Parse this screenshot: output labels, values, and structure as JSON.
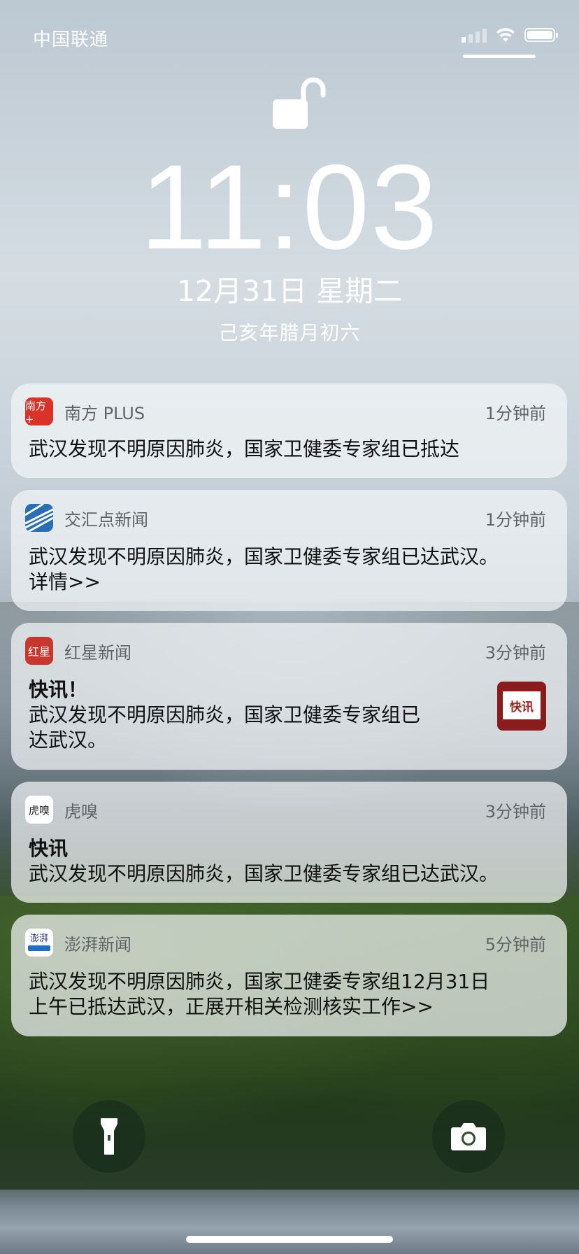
{
  "status_bar": {
    "carrier": "中国联通",
    "signal_bars_active": 1,
    "signal_bars_total": 4,
    "battery_level": 0.95
  },
  "lock": {
    "icon": "unlocked-padlock-icon"
  },
  "clock": {
    "time": "11:03",
    "date": "12月31日 星期二",
    "lunar_date": "己亥年腊月初六"
  },
  "notifications": [
    {
      "app": "南方 PLUS",
      "icon_text": "南方+",
      "icon_color": "#d93228",
      "time": "1分钟前",
      "title": "",
      "body_lines": [
        "武汉发现不明原因肺炎，国家卫健委专家组已抵达"
      ]
    },
    {
      "app": "交汇点新闻",
      "icon_text": "",
      "icon_color": "#2a6fb6",
      "time": "1分钟前",
      "title": "",
      "body_lines": [
        "武汉发现不明原因肺炎，国家卫健委专家组已达武汉。",
        "详情>>"
      ]
    },
    {
      "app": "红星新闻",
      "icon_text": "红星",
      "icon_color": "#c8372d",
      "time": "3分钟前",
      "title": "快讯！",
      "body_lines": [
        "武汉发现不明原因肺炎，国家卫健委专家组已",
        "达武汉。"
      ],
      "thumbnail_text": "快讯"
    },
    {
      "app": "虎嗅",
      "icon_text": "虎嗅",
      "icon_color": "#ffffff",
      "time": "3分钟前",
      "title": "快讯",
      "body_lines": [
        "武汉发现不明原因肺炎，国家卫健委专家组已达武汉。"
      ]
    },
    {
      "app": "澎湃新闻",
      "icon_text": "澎湃",
      "icon_color": "#1f6fc9",
      "time": "5分钟前",
      "title": "",
      "body_lines": [
        "武汉发现不明原因肺炎，国家卫健委专家组12月31日",
        "上午已抵达武汉，正展开相关检测核实工作>>"
      ]
    }
  ],
  "controls": {
    "left": "flashlight-icon",
    "right": "camera-icon"
  }
}
